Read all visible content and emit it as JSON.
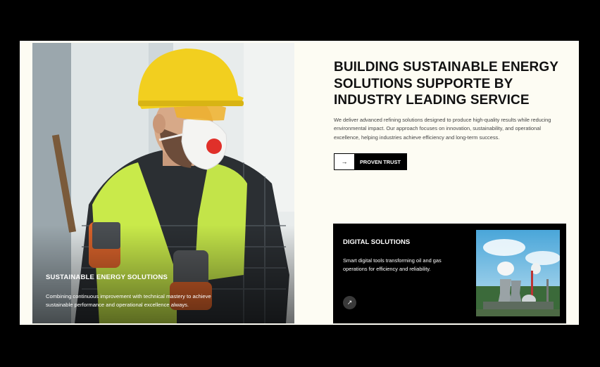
{
  "hero": {
    "headline": "BUILDING SUSTAINABLE ENERGY SOLUTIONS SUPPORTE BY INDUSTRY LEADING SERVICE",
    "intro": "We deliver advanced refining solutions designed to produce high-quality results while reducing environmental impact. Our approach focuses on innovation, sustainability, and operational excellence, helping industries achieve efficiency and long-term success.",
    "cta_label": "PROVEN TRUST",
    "cta_icon": "→"
  },
  "photo_card": {
    "title": "SUSTAINABLE ENERGY SOLUTIONS",
    "description": "Combining continuous improvement with technical mastery to achieve sustainable performance and operational excellence always.",
    "image": "worker-in-hard-hat-and-respirator"
  },
  "digital_card": {
    "title": "DIGITAL SOLUTIONS",
    "description": "Smart digital tools transforming oil and gas operations for efficiency and reliability.",
    "link_icon": "↗",
    "image": "power-plant-cooling-towers"
  },
  "colors": {
    "page_bg": "#fdfcf3",
    "frame": "#000000",
    "vest": "#c8e84a",
    "helmet": "#f2cf1f"
  }
}
